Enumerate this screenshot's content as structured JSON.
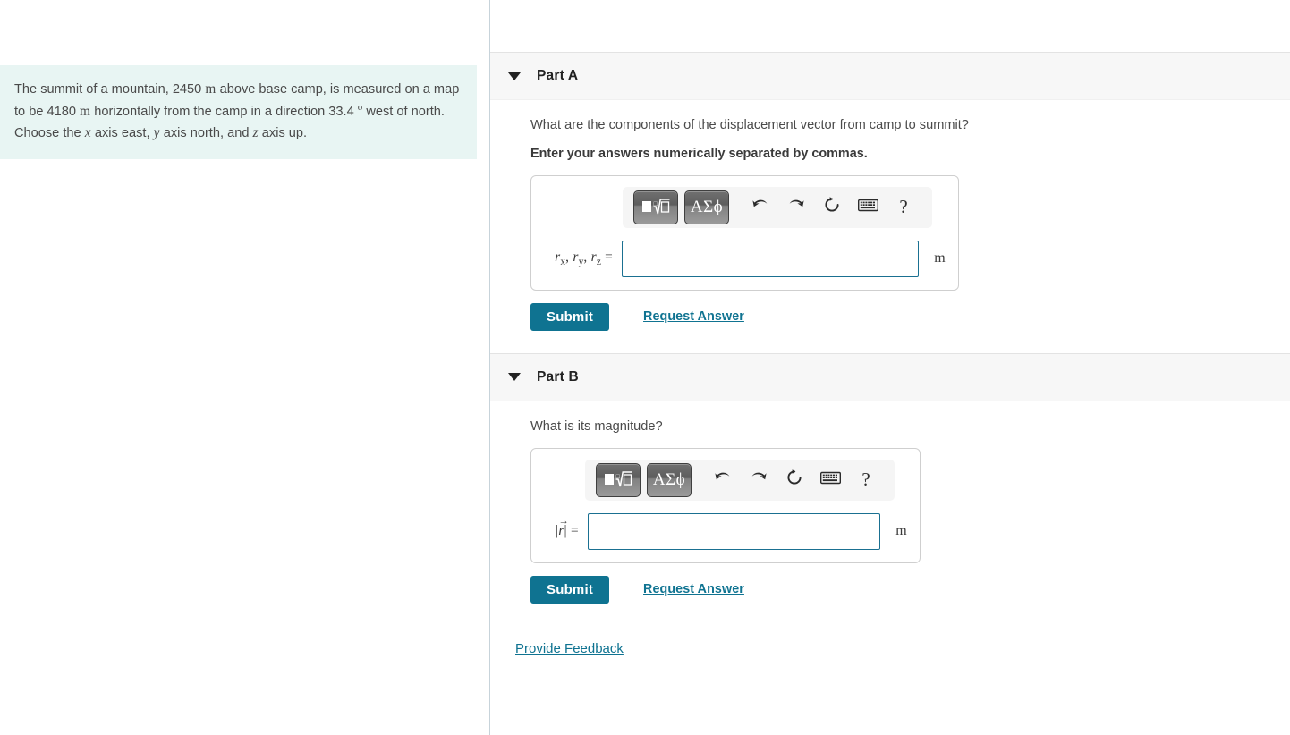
{
  "problem": {
    "text_part1": "The summit of a mountain, 2450 ",
    "unit1": "m",
    "text_part2": " above base camp, is measured on a map to be 4180 ",
    "unit2": "m",
    "text_part3": " horizontally from the camp in a direction 33.4 ",
    "degree": "o",
    "text_part4": " west of north. Choose the ",
    "axis_x": "x",
    "text_part5": " axis east, ",
    "axis_y": "y",
    "text_part6": " axis north, and ",
    "axis_z": "z",
    "text_part7": " axis up."
  },
  "parts": [
    {
      "title": "Part A",
      "question": "What are the components of the displacement vector from camp to summit?",
      "instruction": "Enter your answers numerically separated by commas.",
      "answer_label": "rₓ, rᵧ, rₓ =",
      "answer_value": "",
      "unit": "m",
      "submit_label": "Submit",
      "request_label": "Request Answer"
    },
    {
      "title": "Part B",
      "question": "What is its magnitude?",
      "instruction": "",
      "answer_label": "|r⃗| =",
      "answer_value": "",
      "unit": "m",
      "submit_label": "Submit",
      "request_label": "Request Answer"
    }
  ],
  "mathbar": {
    "template_button": "template-matrix-root",
    "greek_button": "ΑΣϕ",
    "undo": "undo-icon",
    "redo": "redo-icon",
    "reset": "reset-icon",
    "keyboard": "keyboard-icon",
    "help": "?"
  },
  "footer": {
    "feedback_label": "Provide Feedback"
  },
  "colors": {
    "accent": "#0f7391",
    "problem_bg": "#e8f5f3",
    "header_bg": "#f7f7f7",
    "input_border": "#1a7091"
  }
}
